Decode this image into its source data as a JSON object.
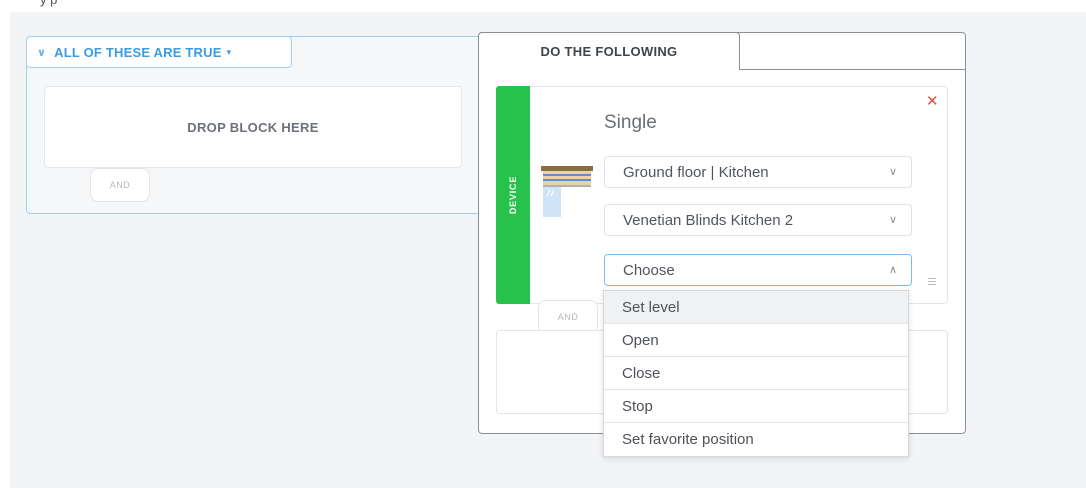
{
  "top_strip": {
    "text": "y     p"
  },
  "condition": {
    "header_label": "ALL OF THESE ARE TRUE",
    "drop_text": "DROP BLOCK HERE",
    "and_label": "AND"
  },
  "action": {
    "tab_label": "DO THE FOLLOWING",
    "stripe_label": "DEVICE",
    "mode_label": "Single",
    "location_select": "Ground floor | Kitchen",
    "device_select": "Venetian Blinds Kitchen 2",
    "action_select": "Choose",
    "and_label": "AND",
    "options": [
      "Set level",
      "Open",
      "Close",
      "Stop",
      "Set favorite position"
    ],
    "highlighted_option": "Set level"
  },
  "colors": {
    "accent_blue": "#3c9be0",
    "device_green": "#27c24c",
    "close_red": "#e74c3c"
  },
  "icons": {
    "collapse": "chevron-down-icon",
    "dropdown_caret": "caret-down-icon",
    "close": "close-icon",
    "device": "venetian-blinds-icon",
    "drag": "grip-icon"
  }
}
